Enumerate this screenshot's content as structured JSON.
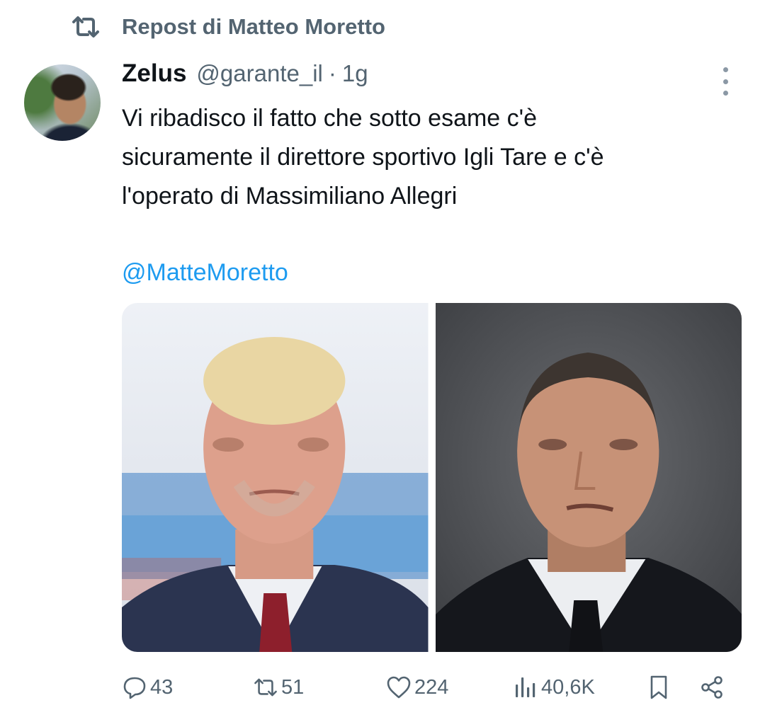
{
  "repost": {
    "icon": "repost-icon",
    "text": "Repost di Matteo Moretto"
  },
  "tweet": {
    "author_name": "Zelus",
    "handle": "@garante_il",
    "separator": "·",
    "time": "1g",
    "text_lines": [
      "Vi ribadisco il fatto che sotto esame c'è",
      "sicuramente il direttore sportivo Igli Tare e c'è",
      "l'operato di Massimiliano Allegri"
    ],
    "mention": "@MatteMoretto",
    "media": [
      {
        "icon": "photo-man-blond-hair-red-tie"
      },
      {
        "icon": "photo-man-bald-black-tie"
      }
    ]
  },
  "actions": {
    "reply_count": "43",
    "repost_count": "51",
    "like_count": "224",
    "views_count": "40,6K"
  },
  "colors": {
    "text": "#0f1419",
    "muted": "#536471",
    "link": "#1d9bf0",
    "background": "#ffffff"
  }
}
